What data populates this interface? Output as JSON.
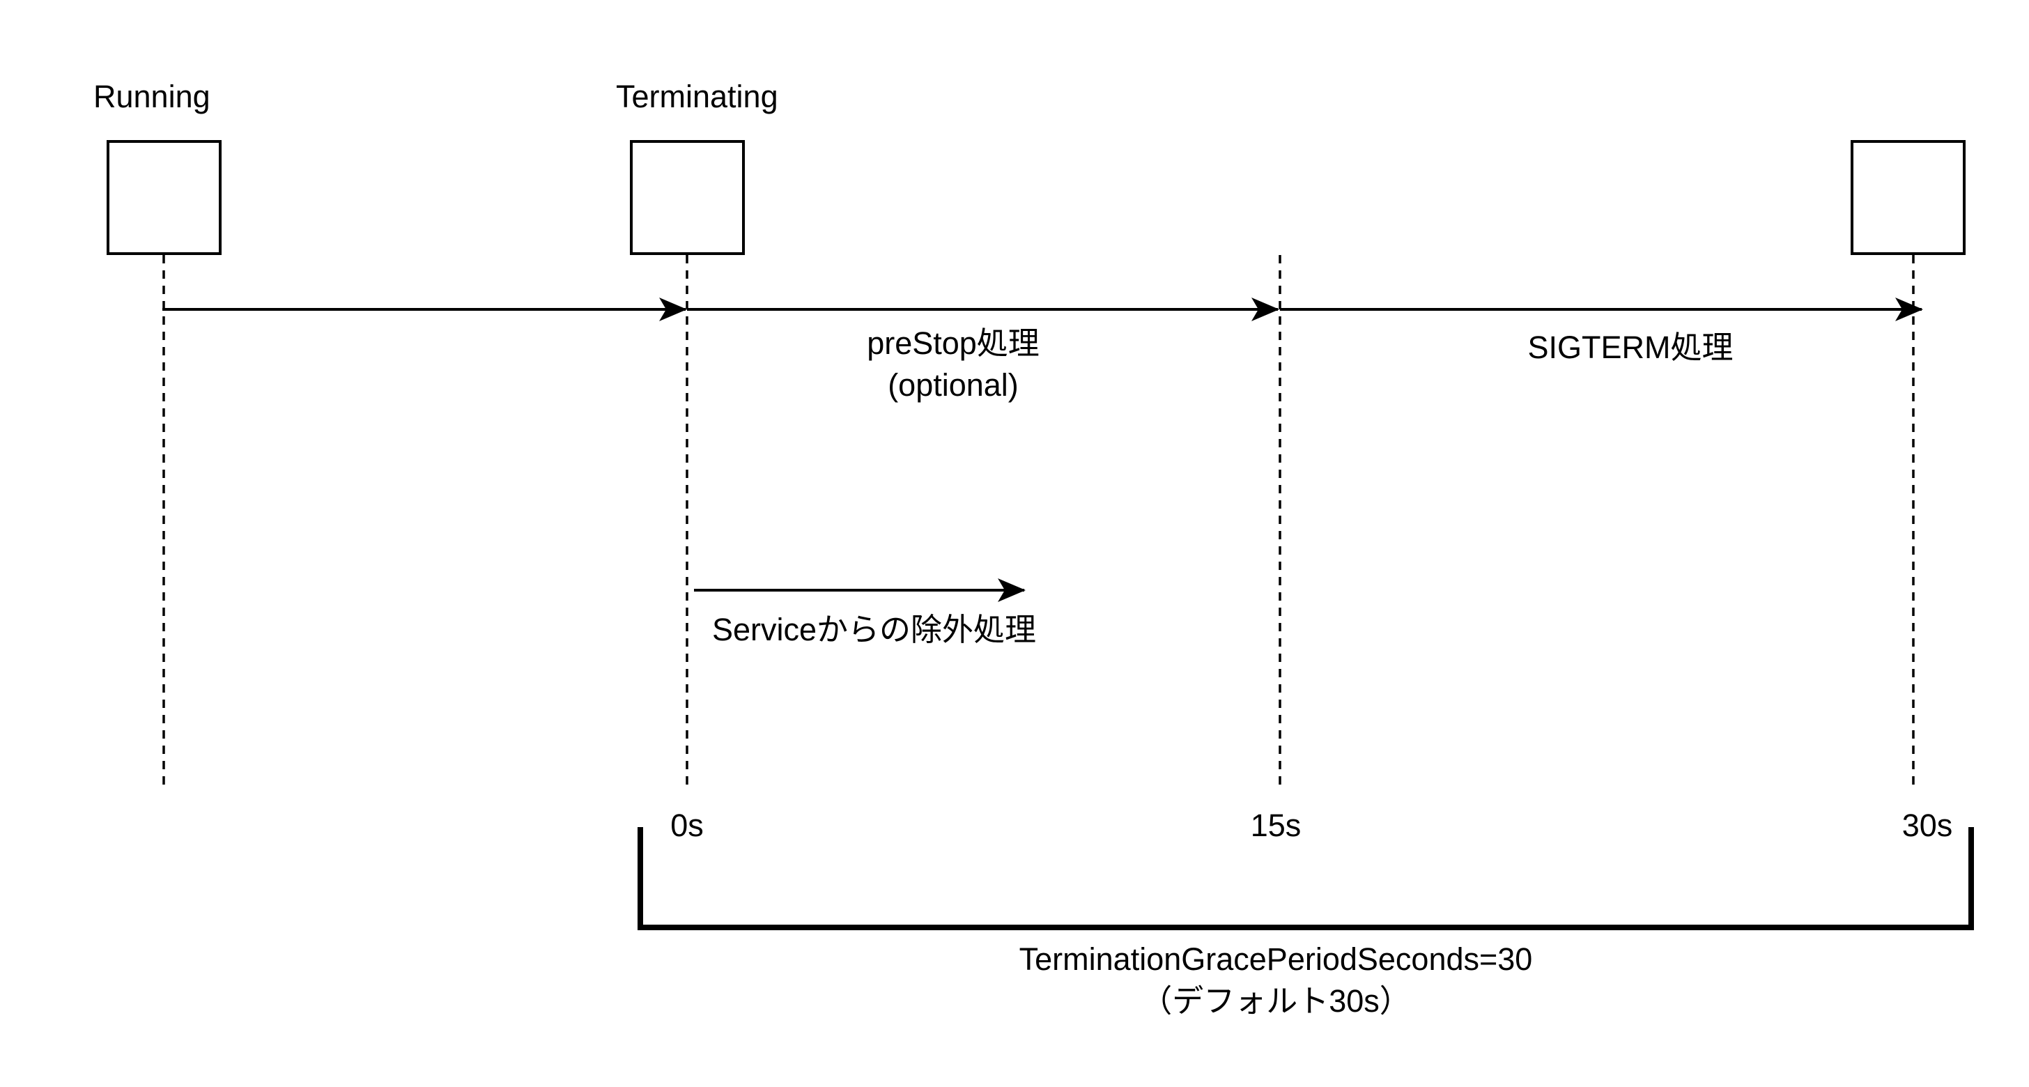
{
  "states": {
    "running_label": "Running",
    "terminating_label": "Terminating"
  },
  "phases": {
    "prestop_label": "preStop処理",
    "prestop_note": "(optional)",
    "sigterm_label": "SIGTERM処理",
    "service_removal_label": "Serviceからの除外処理"
  },
  "timeline": {
    "tick_0": "0s",
    "tick_15": "15s",
    "tick_30": "30s"
  },
  "grace_period": {
    "setting_label": "TerminationGracePeriodSeconds=30",
    "default_note": "（デフォルト30s）"
  }
}
